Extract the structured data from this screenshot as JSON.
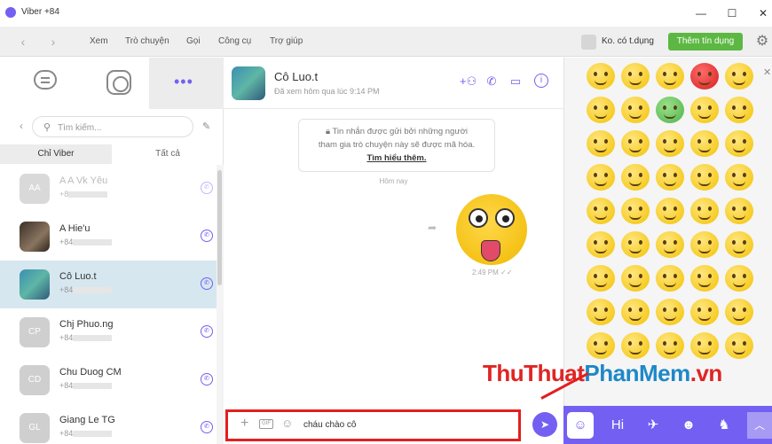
{
  "window": {
    "title": "Viber +84"
  },
  "window_controls": {
    "minimize": "—",
    "maximize": "☐",
    "close": "✕"
  },
  "menu": {
    "items": [
      "Xem",
      "Trò chuyện",
      "Gọi",
      "Công cụ",
      "Trợ giúp"
    ],
    "account_name": "Ko. có t.dụng",
    "credit_button": "Thêm tín dụng"
  },
  "left_panel": {
    "search_placeholder": "Tìm kiếm...",
    "filters": [
      "Chỉ Viber",
      "Tất cả"
    ],
    "contacts": [
      {
        "name": "A A Vk Yêu",
        "phone": "+8",
        "initials": "AA",
        "color": "#cfcfcf"
      },
      {
        "name": "A Hie'u",
        "phone": "+84",
        "initials": "",
        "color": "#5a4a3a"
      },
      {
        "name": "Cô Luo.t",
        "phone": "+84",
        "initials": "",
        "color": "#3a8fb0"
      },
      {
        "name": "Chj Phuo.ng",
        "phone": "+84",
        "initials": "CP",
        "color": "#cfcfcf"
      },
      {
        "name": "Chu Duog CM",
        "phone": "+84",
        "initials": "CD",
        "color": "#cfcfcf"
      },
      {
        "name": "Giang Le TG",
        "phone": "+84",
        "initials": "GL",
        "color": "#cfcfcf"
      }
    ]
  },
  "conversation": {
    "name": "Cô Luo.t",
    "status": "Đã xem hôm qua lúc 9:14 PM",
    "encryption_line1": "Tin nhắn được gửi bởi những người",
    "encryption_line2": "tham gia trò chuyện này sẽ được mã hóa.",
    "encryption_link": "Tìm hiểu thêm.",
    "date_separator": "Hôm nay",
    "message_time": "2:49 PM",
    "input_text": "cháu chào cô"
  },
  "watermark": {
    "part1": "ThuThuat",
    "part2": "PhanMem",
    "part3": ".vn"
  },
  "colors": {
    "accent": "#7360f2",
    "green": "#5cb842",
    "highlight": "#e41e1e"
  }
}
